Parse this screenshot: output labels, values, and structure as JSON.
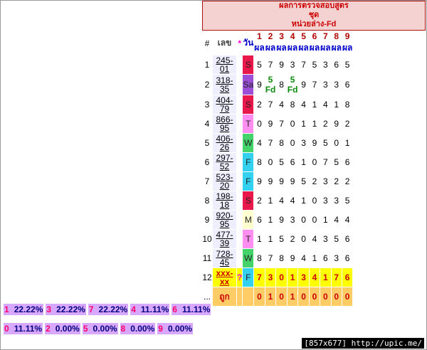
{
  "title": {
    "line1": "ผลการตรวจสอบสูตร",
    "line2": "ชุด",
    "line3": "หน่วยล่าง-Fd"
  },
  "headers": {
    "idx": "#",
    "code": "เลข",
    "star": "*",
    "day": "วัน",
    "cols": [
      {
        "num": "1",
        "label": "ผล"
      },
      {
        "num": "2",
        "label": "ผล"
      },
      {
        "num": "3",
        "label": "ผล"
      },
      {
        "num": "4",
        "label": "ผล"
      },
      {
        "num": "5",
        "label": "ผล"
      },
      {
        "num": "6",
        "label": "ผล"
      },
      {
        "num": "7",
        "label": "ผล"
      },
      {
        "num": "8",
        "label": "ผล"
      },
      {
        "num": "9",
        "label": "ผล"
      }
    ]
  },
  "rows": [
    {
      "idx": "1",
      "code1": "245-",
      "code2": "01",
      "day": "S",
      "vals": [
        "5",
        "7",
        "9",
        "3",
        "7",
        "5",
        "3",
        "6",
        "5"
      ]
    },
    {
      "idx": "2",
      "code1": "318-",
      "code2": "35",
      "day": "Sa",
      "vals": [
        "9",
        "5 Fd",
        "8",
        "5 Fd",
        "9",
        "7",
        "3",
        "3",
        "6"
      ]
    },
    {
      "idx": "3",
      "code1": "404-",
      "code2": "79",
      "day": "S",
      "vals": [
        "2",
        "7",
        "4",
        "8",
        "4",
        "1",
        "4",
        "1",
        "8"
      ]
    },
    {
      "idx": "4",
      "code1": "866-",
      "code2": "95",
      "day": "T",
      "vals": [
        "0",
        "9",
        "7",
        "0",
        "1",
        "1",
        "2",
        "9",
        "2"
      ]
    },
    {
      "idx": "5",
      "code1": "406-",
      "code2": "26",
      "day": "W",
      "vals": [
        "4",
        "7",
        "8",
        "0",
        "3",
        "9",
        "5",
        "0",
        "1"
      ]
    },
    {
      "idx": "6",
      "code1": "297-",
      "code2": "52",
      "day": "F",
      "vals": [
        "8",
        "0",
        "5",
        "6",
        "1",
        "0",
        "7",
        "5",
        "6"
      ]
    },
    {
      "idx": "7",
      "code1": "523-",
      "code2": "20",
      "day": "F",
      "vals": [
        "9",
        "9",
        "9",
        "9",
        "5",
        "2",
        "3",
        "2",
        "2"
      ]
    },
    {
      "idx": "8",
      "code1": "198-",
      "code2": "18",
      "day": "S",
      "vals": [
        "2",
        "1",
        "4",
        "4",
        "1",
        "0",
        "3",
        "3",
        "5"
      ]
    },
    {
      "idx": "9",
      "code1": "920-",
      "code2": "95",
      "day": "M",
      "vals": [
        "6",
        "1",
        "9",
        "3",
        "0",
        "0",
        "1",
        "4",
        "4"
      ]
    },
    {
      "idx": "10",
      "code1": "477-",
      "code2": "39",
      "day": "T",
      "vals": [
        "1",
        "1",
        "5",
        "2",
        "0",
        "4",
        "3",
        "5",
        "6"
      ]
    },
    {
      "idx": "11",
      "code1": "728-",
      "code2": "45",
      "day": "W",
      "vals": [
        "8",
        "7",
        "8",
        "9",
        "4",
        "1",
        "6",
        "3",
        "6"
      ]
    }
  ],
  "row12": {
    "idx": "12",
    "code1": "xxx-",
    "code2": "xx",
    "star": "?",
    "day": "F",
    "vals": [
      "7",
      "3",
      "0",
      "1",
      "3",
      "4",
      "1",
      "7",
      "6"
    ]
  },
  "row_ok": {
    "idx": "...",
    "label": "ถูก",
    "vals": [
      "0",
      "1",
      "0",
      "1",
      "0",
      "0",
      "0",
      "0",
      "0"
    ]
  },
  "stats_row1": [
    {
      "k": "1",
      "v": "22.22%"
    },
    {
      "k": "3",
      "v": "22.22%"
    },
    {
      "k": "7",
      "v": "22.22%"
    },
    {
      "k": "4",
      "v": "11.11%"
    },
    {
      "k": "6",
      "v": "11.11%"
    }
  ],
  "stats_row2": [
    {
      "k": "0",
      "v": "11.11%"
    },
    {
      "k": "2",
      "v": "0.00%"
    },
    {
      "k": "5",
      "v": "0.00%"
    },
    {
      "k": "8",
      "v": "0.00%"
    },
    {
      "k": "9",
      "v": "0.00%"
    }
  ],
  "watermark": "[857x677] http://upic.me/"
}
